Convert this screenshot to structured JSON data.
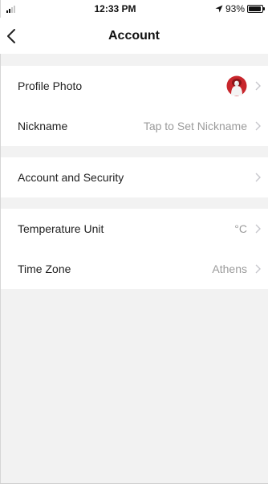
{
  "status_bar": {
    "time": "12:33 PM",
    "battery": "93%",
    "battery_level": 0.93
  },
  "header": {
    "title": "Account"
  },
  "sections": [
    {
      "rows": [
        {
          "label": "Profile Photo",
          "value": ""
        },
        {
          "label": "Nickname",
          "value": "Tap to Set Nickname"
        }
      ]
    },
    {
      "rows": [
        {
          "label": "Account and Security",
          "value": ""
        }
      ]
    },
    {
      "rows": [
        {
          "label": "Temperature Unit",
          "value": "°C"
        },
        {
          "label": "Time Zone",
          "value": "Athens"
        }
      ]
    }
  ],
  "colors": {
    "avatar_red": "#c8262c",
    "chevron": "#c7c7cc",
    "secondary_text": "#9b9b9b"
  }
}
